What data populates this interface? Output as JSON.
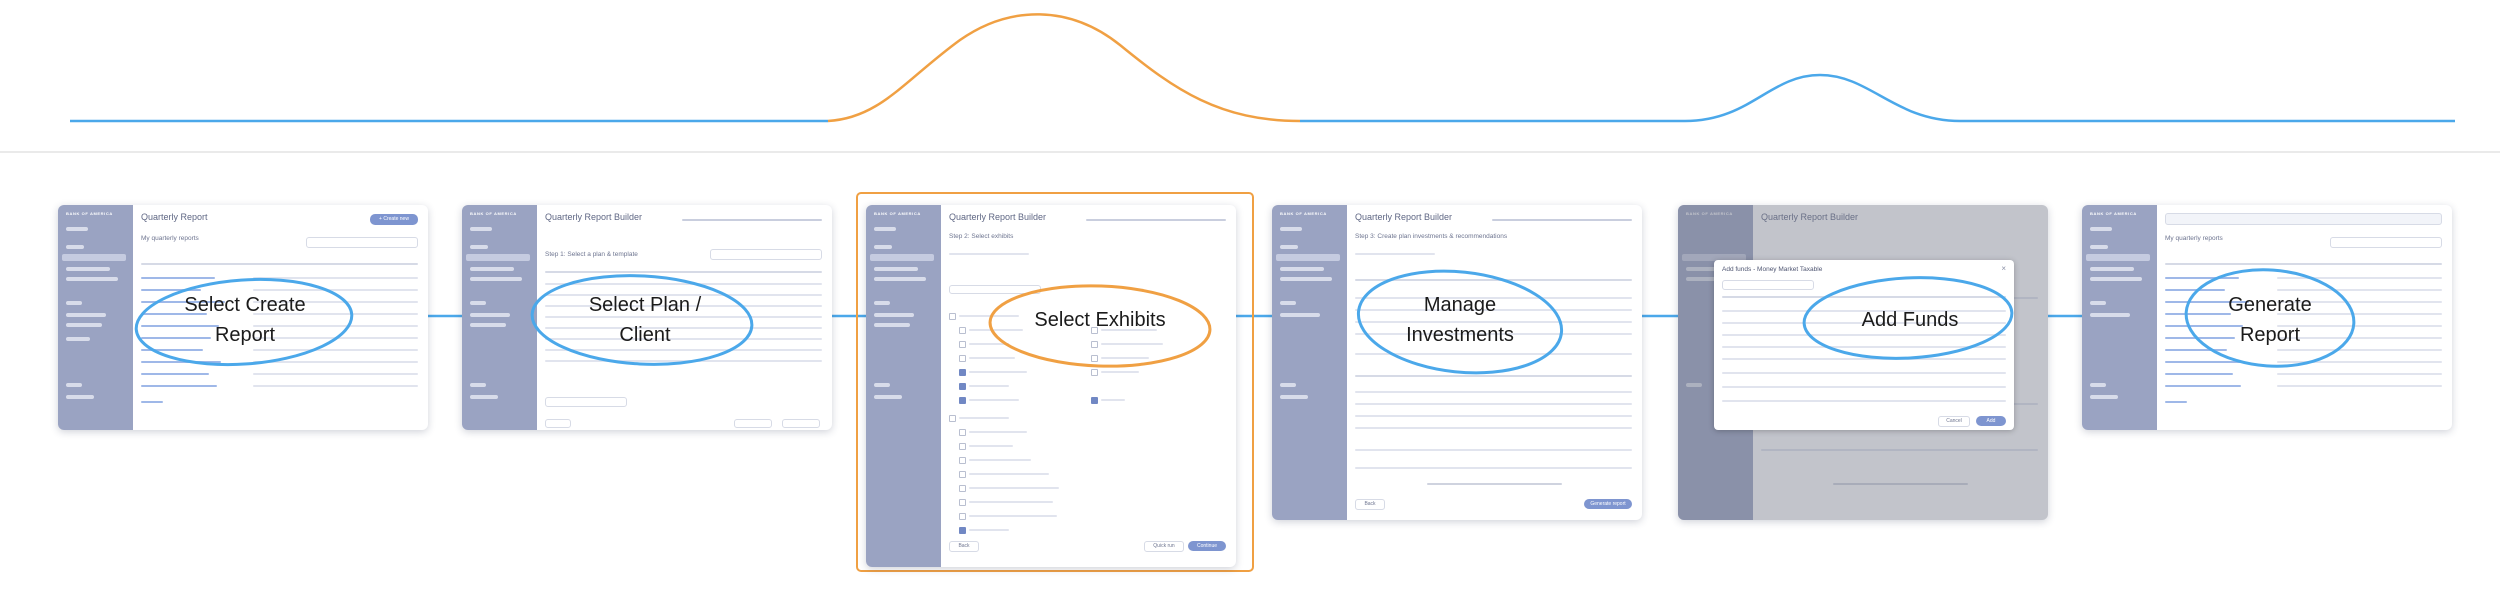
{
  "colors": {
    "flow_blue": "#4ba8ea",
    "accent_orange": "#f0a043",
    "sidebar": "#9aa3c2",
    "divider": "#e3e3e3"
  },
  "steps": [
    {
      "id": "select-create-report",
      "label_lines": [
        "Select Create",
        "Report"
      ],
      "screen": {
        "brand": "BANK OF AMERICA",
        "title": "Quarterly Report",
        "subtitle": "My quarterly reports",
        "primary_button": "+ Create new"
      }
    },
    {
      "id": "select-plan-client",
      "label_lines": [
        "Select Plan /",
        "Client"
      ],
      "screen": {
        "brand": "BANK OF AMERICA",
        "title": "Quarterly Report Builder",
        "subtitle": "Step 1: Select a plan & template"
      }
    },
    {
      "id": "select-exhibits",
      "label_lines": [
        "Select Exhibits"
      ],
      "screen": {
        "brand": "BANK OF AMERICA",
        "title": "Quarterly Report Builder",
        "subtitle": "Step 2: Select exhibits",
        "footer_back": "Back",
        "footer_quick": "Quick run",
        "footer_continue": "Continue"
      }
    },
    {
      "id": "manage-investments",
      "label_lines": [
        "Manage",
        "Investments"
      ],
      "screen": {
        "brand": "BANK OF AMERICA",
        "title": "Quarterly Report Builder",
        "subtitle": "Step 3: Create plan investments & recommendations",
        "footer_back": "Back",
        "footer_generate": "Generate report"
      }
    },
    {
      "id": "add-funds",
      "label_lines": [
        "Add Funds"
      ],
      "screen": {
        "brand": "BANK OF AMERICA",
        "title": "Quarterly Report Builder",
        "modal_title": "Add funds - Money Market Taxable",
        "modal_cancel": "Cancel",
        "modal_add": "Add"
      }
    },
    {
      "id": "generate-report",
      "label_lines": [
        "Generate",
        "Report"
      ],
      "screen": {
        "brand": "BANK OF AMERICA",
        "subtitle": "My quarterly reports"
      }
    }
  ]
}
